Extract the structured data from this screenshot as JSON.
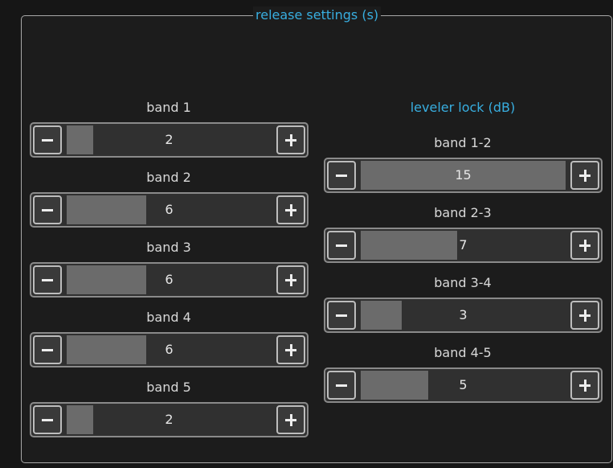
{
  "panel": {
    "title": "release settings (s)"
  },
  "release_bands": [
    {
      "label": "band 1",
      "value": "2",
      "fraction": 0.13
    },
    {
      "label": "band 2",
      "value": "6",
      "fraction": 0.39
    },
    {
      "label": "band 3",
      "value": "6",
      "fraction": 0.39
    },
    {
      "label": "band 4",
      "value": "6",
      "fraction": 0.39
    },
    {
      "label": "band 5",
      "value": "2",
      "fraction": 0.13
    }
  ],
  "leveler": {
    "title": "leveler lock (dB)",
    "items": [
      {
        "label": "band 1-2",
        "value": "15",
        "fraction": 1.0
      },
      {
        "label": "band 2-3",
        "value": "7",
        "fraction": 0.47
      },
      {
        "label": "band 3-4",
        "value": "3",
        "fraction": 0.2
      },
      {
        "label": "band 4-5",
        "value": "5",
        "fraction": 0.33
      }
    ]
  },
  "icons": {
    "decrement": "minus-icon",
    "increment": "plus-icon"
  },
  "colors": {
    "accent": "#38aee0",
    "fill": "#6b6b6b",
    "background": "#1c1c1c"
  }
}
